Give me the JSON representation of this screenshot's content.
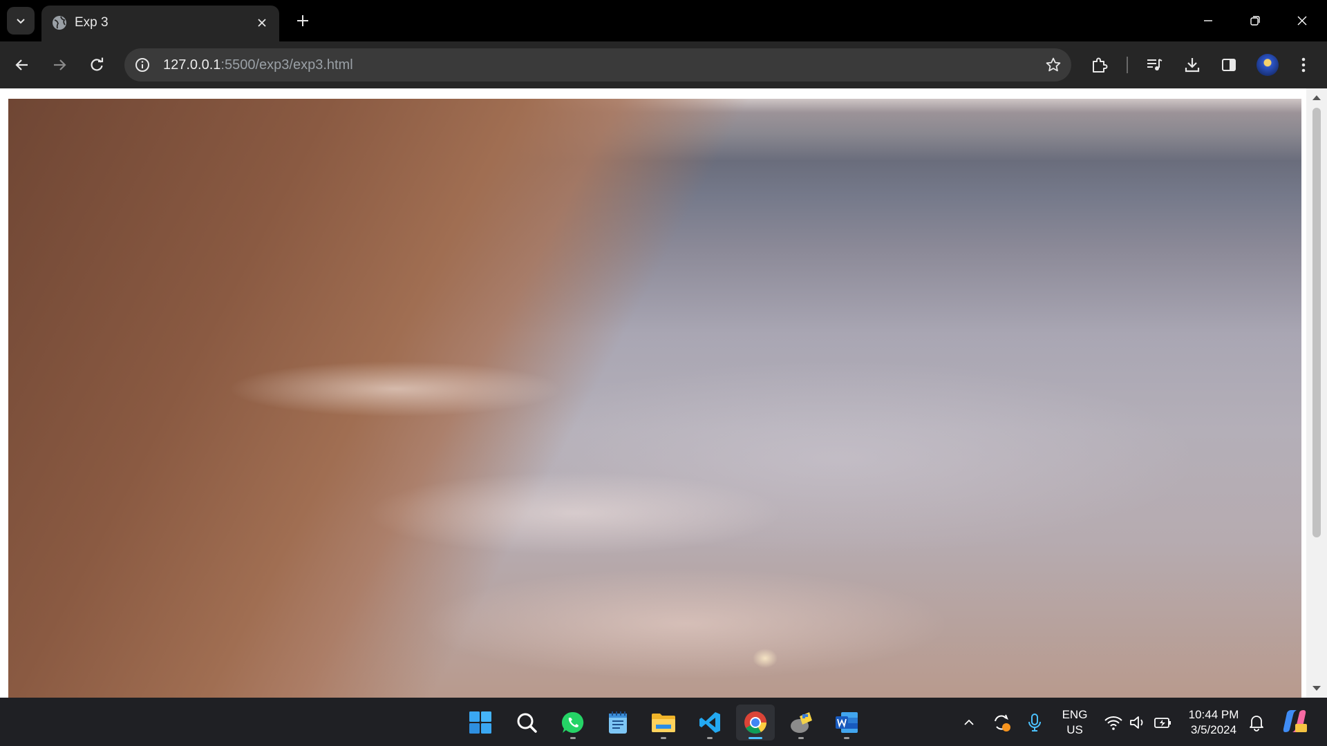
{
  "browser": {
    "tab": {
      "title": "Exp 3"
    },
    "address": {
      "host": "127.0.0.1",
      "rest": ":5500/exp3/exp3.html"
    }
  },
  "page": {
    "content": "video-frame-beach-shoreline"
  },
  "taskbar": {
    "apps": [
      "start",
      "search",
      "whatsapp",
      "notepad",
      "file-explorer",
      "vscode",
      "chrome",
      "python-idle",
      "word"
    ],
    "language": {
      "line1": "ENG",
      "line2": "US"
    },
    "clock": {
      "time": "10:44 PM",
      "date": "3/5/2024"
    }
  },
  "colors": {
    "accent": "#4cc2ff",
    "tab_bg": "#262626",
    "taskbar_bg": "#1f2024"
  }
}
